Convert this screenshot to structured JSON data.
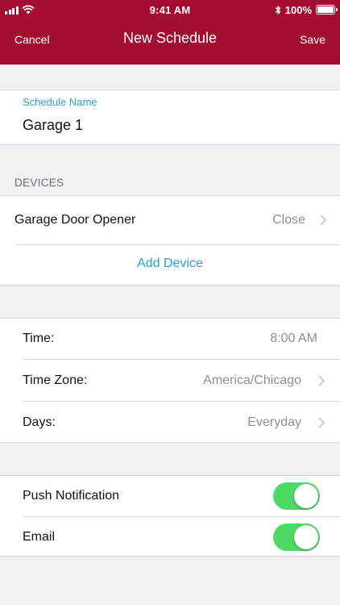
{
  "status_bar": {
    "time": "9:41 AM",
    "battery_percent": "100%",
    "battery_level": 1.0,
    "icons": [
      "signal-icon",
      "wifi-icon",
      "bluetooth-icon",
      "battery-icon"
    ]
  },
  "nav": {
    "cancel_label": "Cancel",
    "title": "New Schedule",
    "save_label": "Save"
  },
  "schedule_name": {
    "label": "Schedule Name",
    "value": "Garage 1"
  },
  "devices": {
    "section_title": "DEVICES",
    "items": [
      {
        "name": "Garage Door Opener",
        "action": "Close"
      }
    ],
    "add_label": "Add Device"
  },
  "schedule": {
    "time_label": "Time:",
    "time_value": "8:00 AM",
    "timezone_label": "Time Zone:",
    "timezone_value": "America/Chicago",
    "days_label": "Days:",
    "days_value": "Everyday"
  },
  "notifications": {
    "push_label": "Push Notification",
    "push_enabled": true,
    "email_label": "Email",
    "email_enabled": true
  },
  "colors": {
    "header": "#a30d31",
    "accent": "#2b9fd0",
    "toggle_on": "#4cd964",
    "background": "#efeff4"
  }
}
